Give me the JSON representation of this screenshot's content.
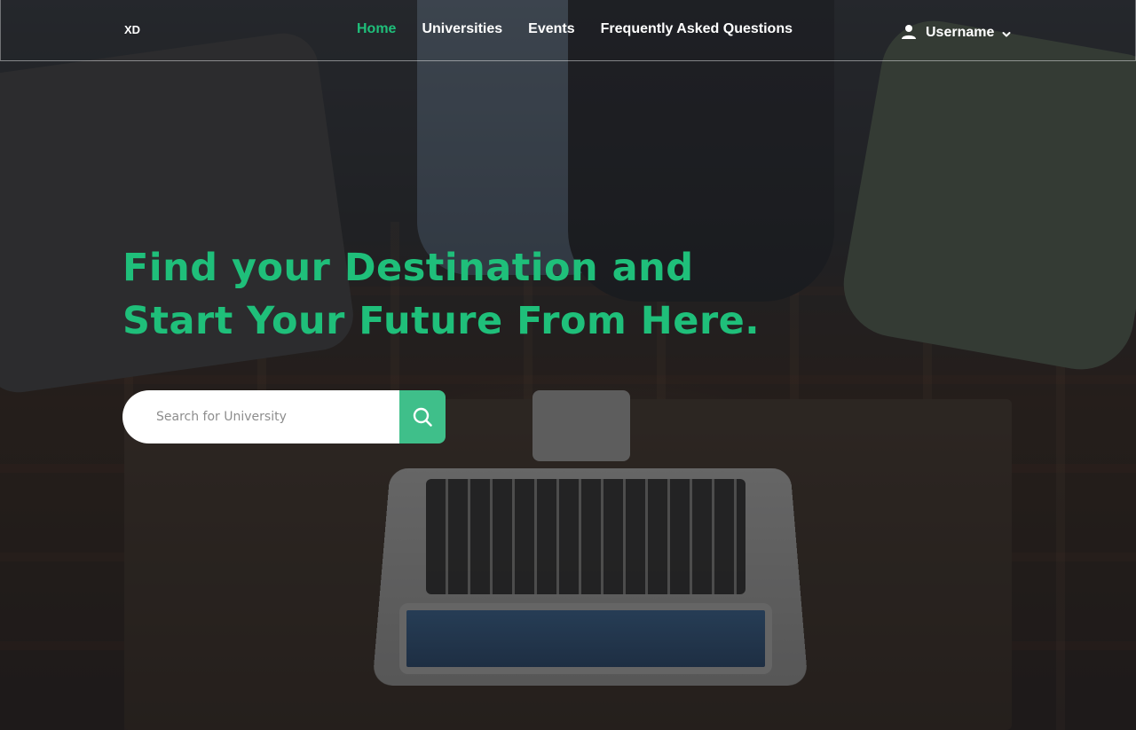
{
  "header": {
    "logo": "XD",
    "nav": [
      {
        "label": "Home",
        "active": true
      },
      {
        "label": "Universities",
        "active": false
      },
      {
        "label": "Events",
        "active": false
      },
      {
        "label": "Frequently Asked Questions",
        "active": false
      }
    ],
    "user": {
      "name": "Username",
      "icon": "user-icon",
      "dropdown_icon": "chevron-down-icon"
    }
  },
  "hero": {
    "title_line1": "Find your Destination and",
    "title_line2": "Start Your Future From Here.",
    "search": {
      "placeholder": "Search for University",
      "value": "",
      "button_icon": "search-icon"
    }
  },
  "colors": {
    "accent": "#1fbf7a",
    "search_button": "#3fbf8a",
    "text_light": "#ffffff"
  }
}
